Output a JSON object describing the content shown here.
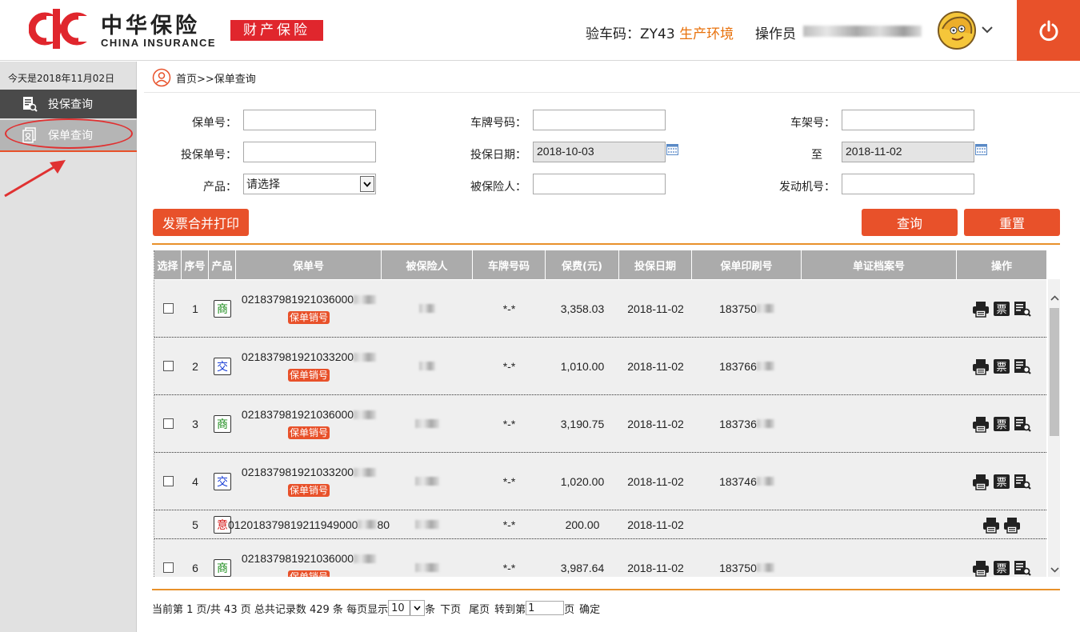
{
  "header": {
    "brand_cn": "中华保险",
    "brand_en": "CHINA INSURANCE",
    "brand_tag": "财产保险",
    "verify_label": "验车码：ZY43",
    "env_label": "生产环境",
    "operator_label": "操作员",
    "power_icon": "power-icon",
    "accent_color": "#e8512a"
  },
  "sidebar": {
    "today": "今天是2018年11月02日",
    "items": [
      {
        "label": "投保查询",
        "icon": "document-search-icon"
      },
      {
        "label": "保单查询",
        "icon": "policy-document-icon"
      }
    ]
  },
  "breadcrumb": {
    "text": "首页>>保单查询"
  },
  "form": {
    "policy_no_label": "保单号：",
    "plate_label": "车牌号码：",
    "vin_label": "车架号：",
    "proposal_no_label": "投保单号：",
    "date_label": "投保日期：",
    "date_from": "2018-10-03",
    "to_label": "至",
    "date_to": "2018-11-02",
    "product_label": "产品：",
    "product_value": "请选择",
    "insured_label": "被保险人：",
    "engine_label": "发动机号："
  },
  "buttons": {
    "merge_print": "发票合并打印",
    "search": "查询",
    "reset": "重置"
  },
  "table": {
    "headers": [
      "选择",
      "序号",
      "产品",
      "保单号",
      "被保险人",
      "车牌号码",
      "保费(元)",
      "投保日期",
      "保单印刷号",
      "单证档案号",
      "操作"
    ],
    "rows": [
      {
        "seq": "1",
        "product": "商",
        "product_color": "green",
        "policy": "021837981921036000",
        "tag": "保单销号",
        "plate": "*-*",
        "premium": "3,358.03",
        "date": "2018-11-02",
        "print_no": "183750"
      },
      {
        "seq": "2",
        "product": "交",
        "product_color": "blue",
        "policy": "021837981921033200",
        "tag": "保单销号",
        "plate": "*-*",
        "premium": "1,010.00",
        "date": "2018-11-02",
        "print_no": "183766"
      },
      {
        "seq": "3",
        "product": "商",
        "product_color": "green",
        "policy": "021837981921036000",
        "tag": "保单销号",
        "plate": "*-*",
        "premium": "3,190.75",
        "date": "2018-11-02",
        "print_no": "183736"
      },
      {
        "seq": "4",
        "product": "交",
        "product_color": "blue",
        "policy": "021837981921033200",
        "tag": "保单销号",
        "plate": "*-*",
        "premium": "1,020.00",
        "date": "2018-11-02",
        "print_no": "183746"
      },
      {
        "seq": "5",
        "product": "意",
        "product_color": "red",
        "policy": "012018379819211949000",
        "policy_suffix": "80",
        "tag": "",
        "plate": "*-*",
        "premium": "200.00",
        "date": "2018-11-02",
        "print_no": ""
      },
      {
        "seq": "6",
        "product": "商",
        "product_color": "green",
        "policy": "021837981921036000",
        "tag": "保单销号",
        "plate": "*-*",
        "premium": "3,987.64",
        "date": "2018-11-02",
        "print_no": "183750"
      }
    ]
  },
  "pager": {
    "summary": "当前第 1 页/共 43 页 总共记录数 429 条 每页显示",
    "page_size": "10",
    "unit": "条",
    "next": "下页",
    "last": "尾页",
    "goto": "转到第",
    "goto_value": "1",
    "page_unit": "页",
    "confirm": "确定"
  }
}
